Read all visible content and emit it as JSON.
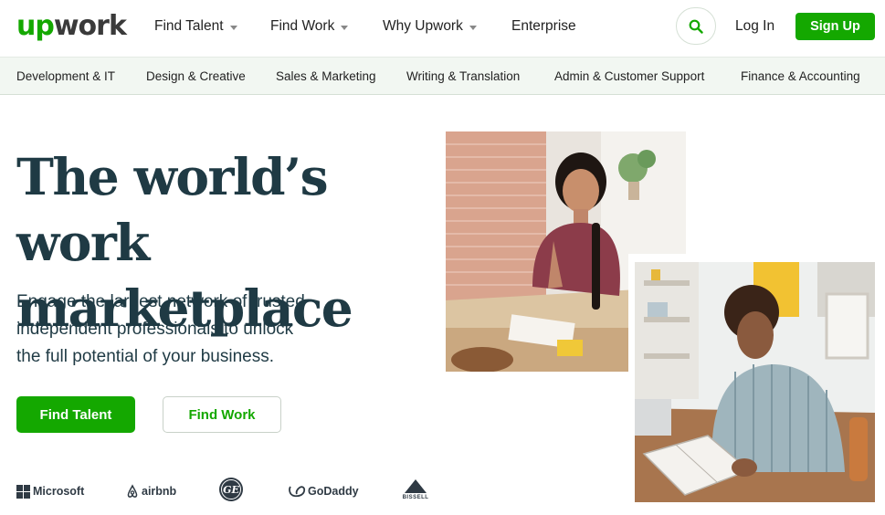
{
  "header": {
    "logo_up": "up",
    "logo_work": "work",
    "nav": [
      {
        "label": "Find Talent"
      },
      {
        "label": "Find Work"
      },
      {
        "label": "Why Upwork"
      },
      {
        "label": "Enterprise"
      }
    ],
    "login": "Log In",
    "signup": "Sign Up"
  },
  "categories": [
    "Development & IT",
    "Design & Creative",
    "Sales & Marketing",
    "Writing & Translation",
    "Admin & Customer Support",
    "Finance & Accounting"
  ],
  "hero": {
    "title_line1": "The world’s work",
    "title_line2": "marketplace",
    "sub_line1": "Engage the largest network of trusted",
    "sub_line2": "independent professionals to unlock",
    "sub_line3": "the full potential of your business.",
    "btn_talent": "Find Talent",
    "btn_work": "Find Work"
  },
  "brands": {
    "microsoft": "Microsoft",
    "airbnb": "airbnb",
    "ge": "GE",
    "godaddy": "GoDaddy",
    "bissell": "BISSELL"
  },
  "colors": {
    "brand_green": "#14a800",
    "title_color": "#1f3a44",
    "category_bar": "#f2f7f2"
  },
  "icons": {
    "search": "search-icon",
    "caret": "chevron-down-icon"
  }
}
